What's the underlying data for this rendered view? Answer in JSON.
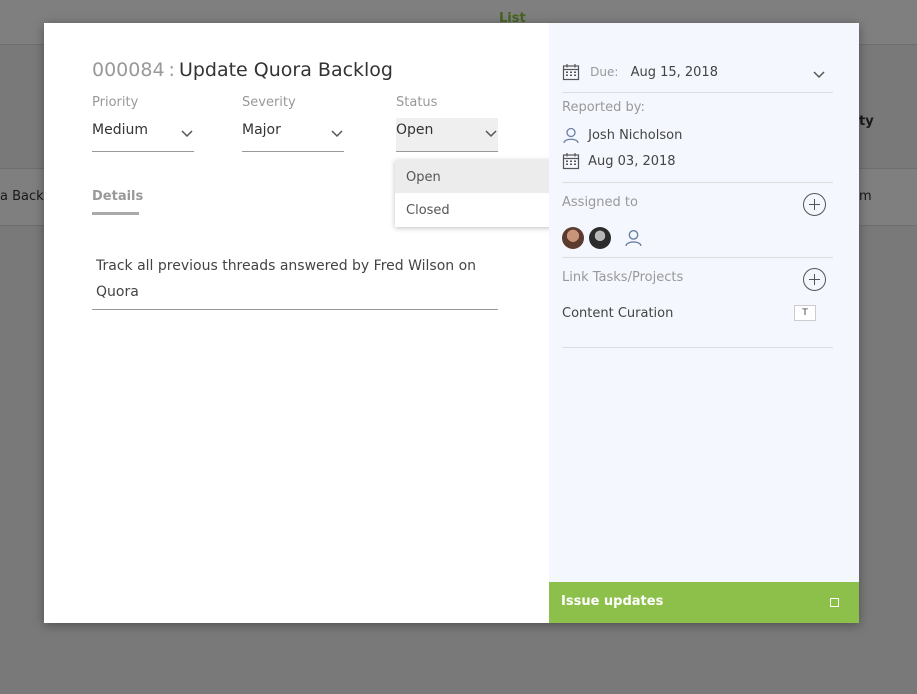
{
  "background": {
    "list_tab": "List",
    "row_left_text": "a Backl",
    "row_right_text": "m",
    "right_header": "ty"
  },
  "issue": {
    "number": "000084",
    "separator": ":",
    "title": "Update Quora Backlog",
    "description": "Track all previous threads answered by Fred Wilson on Quora"
  },
  "fields": {
    "priority": {
      "label": "Priority",
      "value": "Medium"
    },
    "severity": {
      "label": "Severity",
      "value": "Major"
    },
    "status": {
      "label": "Status",
      "value": "Open"
    }
  },
  "status_options": [
    "Open",
    "Closed"
  ],
  "tabs": {
    "details": "Details"
  },
  "sidebar": {
    "due_label": "Due:",
    "due_date": "Aug 15, 2018",
    "reported_label": "Reported by:",
    "reporter": "Josh Nicholson",
    "reported_date": "Aug 03, 2018",
    "assigned_label": "Assigned to",
    "link_label": "Link Tasks/Projects",
    "linked_item": "Content Curation",
    "linked_type": "T"
  },
  "footer": {
    "issue_updates": "Issue updates"
  },
  "colors": {
    "accent": "#8cc04b",
    "right_pane_bg": "#f4f7fd"
  },
  "icons": [
    "calendar-icon",
    "user-icon",
    "plus-circle-icon",
    "chevron-down-icon",
    "square-icon"
  ]
}
